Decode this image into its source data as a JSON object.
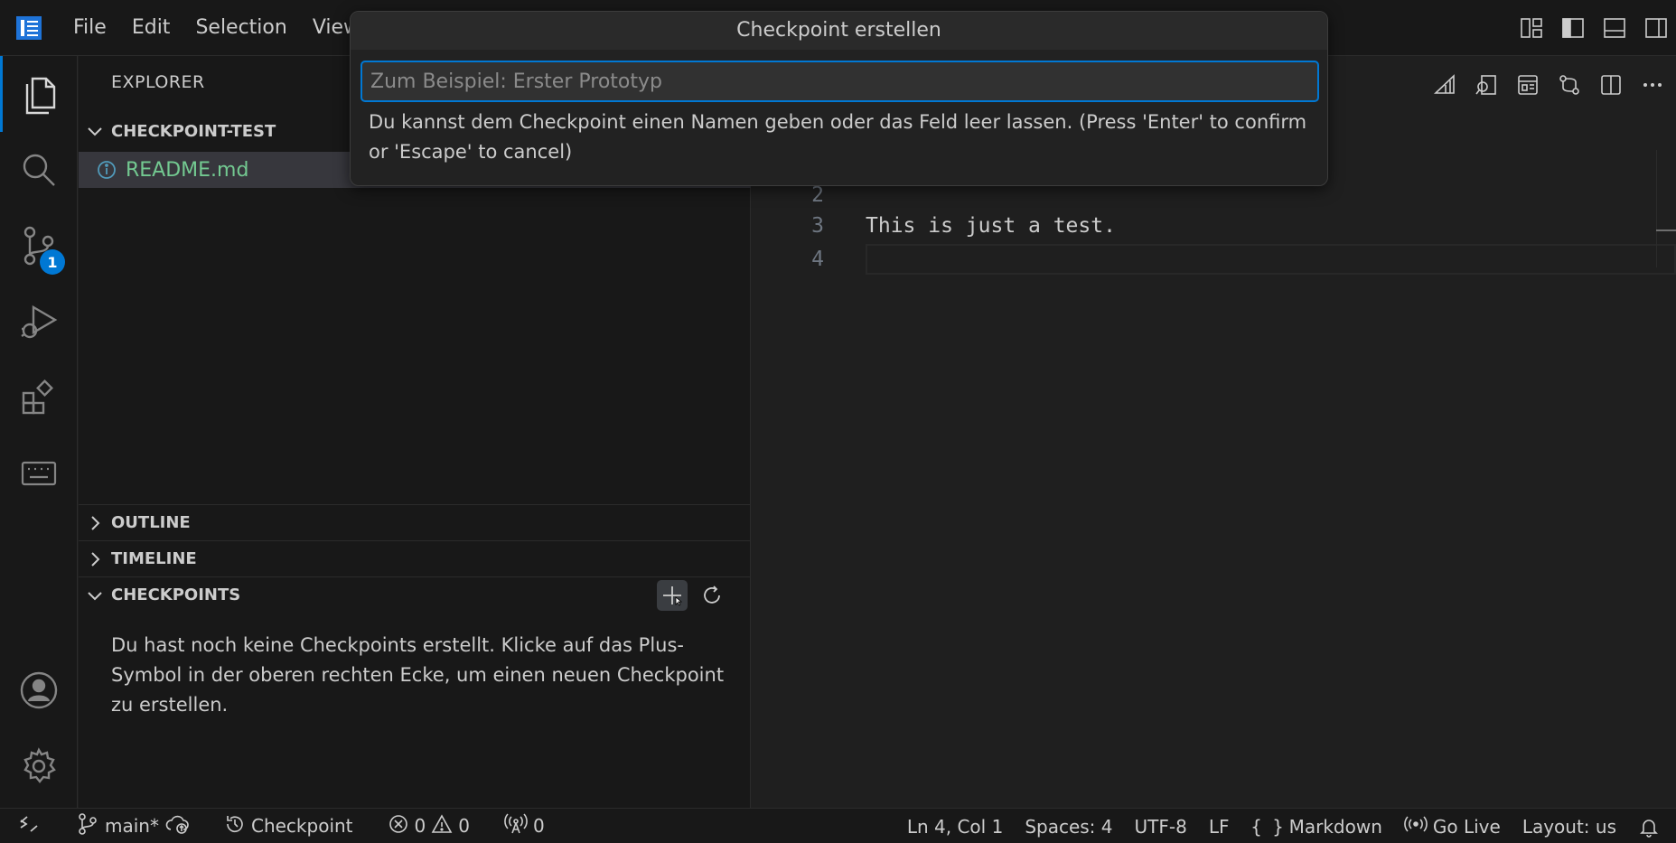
{
  "menu": {
    "file": "File",
    "edit": "Edit",
    "selection": "Selection",
    "view": "View"
  },
  "explorer": {
    "title": "EXPLORER",
    "folder": "CHECKPOINT-TEST",
    "files": [
      {
        "name": "README.md",
        "icon": "info-icon"
      }
    ]
  },
  "sections": {
    "outline": "OUTLINE",
    "timeline": "TIMELINE",
    "checkpoints": "CHECKPOINTS",
    "checkpoints_empty": "Du hast noch keine Checkpoints erstellt. Klicke auf das Plus-Symbol in der oberen rechten Ecke, um einen neuen Checkpoint zu erstellen."
  },
  "source_control_badge": "1",
  "editor": {
    "lines": [
      {
        "num": "2",
        "text": ""
      },
      {
        "num": "3",
        "text": "This is just a test."
      },
      {
        "num": "4",
        "text": ""
      }
    ]
  },
  "quick_input": {
    "title": "Checkpoint erstellen",
    "placeholder": "Zum Beispiel: Erster Prototyp",
    "value": "",
    "message": "Du kannst dem Checkpoint einen Namen geben oder das Feld leer lassen. (Press 'Enter' to confirm or 'Escape' to cancel)"
  },
  "status": {
    "branch": "main*",
    "checkpoint": "Checkpoint",
    "errors": "0",
    "warnings": "0",
    "ports": "0",
    "position": "Ln 4, Col 1",
    "spaces": "Spaces: 4",
    "encoding": "UTF-8",
    "eol": "LF",
    "language": "Markdown",
    "golive": "Go Live",
    "layout": "Layout: us"
  },
  "colors": {
    "accent": "#0078d4",
    "modified_file": "#73c991",
    "background": "#1f1f1f",
    "sidebar": "#181818"
  }
}
